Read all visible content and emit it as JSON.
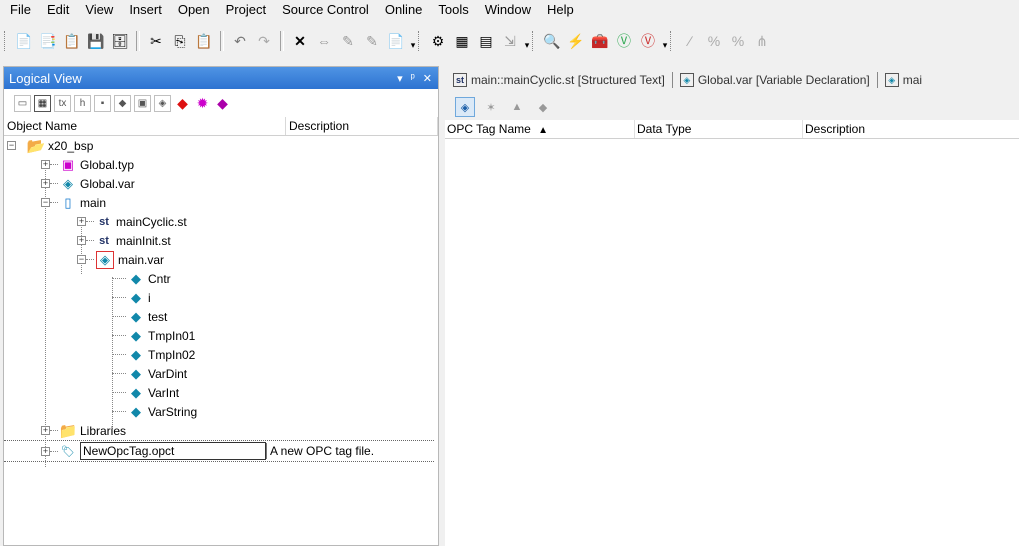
{
  "menu": [
    "File",
    "Edit",
    "View",
    "Insert",
    "Open",
    "Project",
    "Source Control",
    "Online",
    "Tools",
    "Window",
    "Help"
  ],
  "logical_view": {
    "title": "Logical View",
    "controls": [
      "▾",
      "ᵖ",
      "✕"
    ],
    "columns": [
      "Object Name",
      "Description"
    ],
    "tree": {
      "root": "x20_bsp",
      "global_typ": "Global.typ",
      "global_var": "Global.var",
      "main": "main",
      "main_cyclic": "mainCyclic.st",
      "main_init": "mainInit.st",
      "main_var": "main.var",
      "variables": [
        "Cntr",
        "i",
        "test",
        "TmpIn01",
        "TmpIn02",
        "VarDint",
        "VarInt",
        "VarString"
      ],
      "libraries": "Libraries",
      "new_opc_tag": "NewOpcTag.opct",
      "new_opc_tag_desc": "A new OPC tag file."
    }
  },
  "tabs": [
    {
      "label": "main::mainCyclic.st [Structured Text]",
      "icon": "st-file-icon"
    },
    {
      "label": "Global.var [Variable Declaration]",
      "icon": "var-file-icon"
    },
    {
      "label": "mai",
      "icon": "var-file-icon"
    }
  ],
  "opc_grid": {
    "columns": [
      "OPC Tag Name",
      "Data Type",
      "Description"
    ],
    "sort_indicator": "▲"
  },
  "colors": {
    "title_bar": "#3a82dc",
    "tree_line": "#888888"
  }
}
